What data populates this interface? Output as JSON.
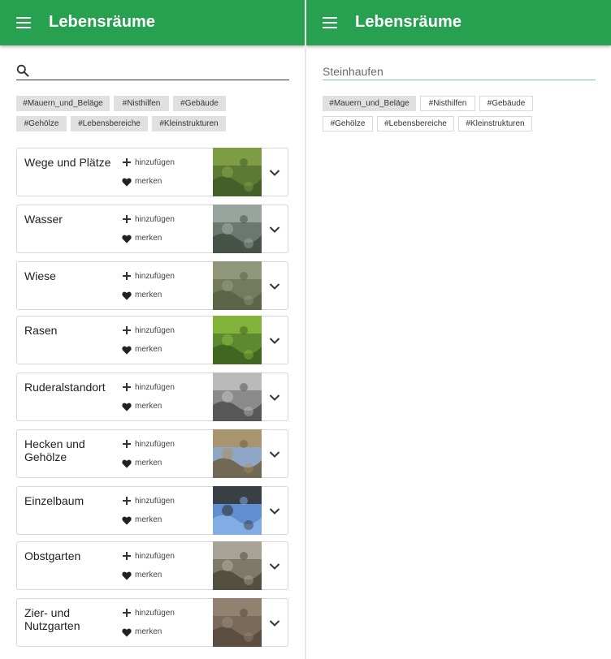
{
  "left": {
    "appbar": {
      "title": "Lebensräume",
      "menu_icon": "menu-icon"
    },
    "search": {
      "value": "",
      "placeholder": "",
      "icon": "search-icon"
    },
    "tags": [
      {
        "label": "#Mauern_und_Beläge"
      },
      {
        "label": "#Nisthilfen"
      },
      {
        "label": "#Gebäude"
      },
      {
        "label": "#Gehölze"
      },
      {
        "label": "#Lebensbereiche"
      },
      {
        "label": "#Kleinstrukturen"
      }
    ],
    "cards": [
      {
        "title": "Wege und Plätze",
        "add_label": "hinzufügen",
        "fav_label": "merken",
        "thumb_colors": [
          "#5d7a35",
          "#8aa84a",
          "#3e5a25"
        ]
      },
      {
        "title": "Wasser",
        "add_label": "hinzufügen",
        "fav_label": "merken",
        "thumb_colors": [
          "#6c7770",
          "#a7b3ae",
          "#3d4a40"
        ]
      },
      {
        "title": "Wiese",
        "add_label": "hinzufügen",
        "fav_label": "merken",
        "thumb_colors": [
          "#747a5e",
          "#9aa082",
          "#55603f"
        ]
      },
      {
        "title": "Rasen",
        "add_label": "hinzufügen",
        "fav_label": "merken",
        "thumb_colors": [
          "#5d8a2f",
          "#8fbf3f",
          "#3b5c1d"
        ]
      },
      {
        "title": "Ruderalstandort",
        "add_label": "hinzufügen",
        "fav_label": "merken",
        "thumb_colors": [
          "#8a8a8a",
          "#c9c9c9",
          "#4a4a4a"
        ]
      },
      {
        "title": "Hecken und Gehölze",
        "add_label": "hinzufügen",
        "fav_label": "merken",
        "thumb_colors": [
          "#8fa6c4",
          "#b08e52",
          "#6a5a3a"
        ]
      },
      {
        "title": "Einzelbaum",
        "add_label": "hinzufügen",
        "fav_label": "merken",
        "thumb_colors": [
          "#5f8fd0",
          "#2d2418",
          "#8ab4e8"
        ]
      },
      {
        "title": "Obstgarten",
        "add_label": "hinzufügen",
        "fav_label": "merken",
        "thumb_colors": [
          "#7e7a6a",
          "#b5b2a6",
          "#4a4636"
        ]
      },
      {
        "title": "Zier- und Nutzgarten",
        "add_label": "hinzufügen",
        "fav_label": "merken",
        "thumb_colors": [
          "#7a6a5a",
          "#9a8a78",
          "#54463a"
        ]
      }
    ]
  },
  "right": {
    "appbar": {
      "title": "Lebensräume",
      "menu_icon": "menu-icon"
    },
    "search": {
      "value": "Steinhaufen"
    },
    "tags": [
      {
        "label": "#Mauern_und_Beläge",
        "active": true
      },
      {
        "label": "#Nisthilfen",
        "active": false
      },
      {
        "label": "#Gebäude",
        "active": false
      },
      {
        "label": "#Gehölze",
        "active": false
      },
      {
        "label": "#Lebensbereiche",
        "active": false
      },
      {
        "label": "#Kleinstrukturen",
        "active": false
      }
    ]
  },
  "colors": {
    "appbar": "#27a050",
    "tag_fill": "#e0e0e0",
    "card_border": "#d8d8d8",
    "search_underline_active": "#7fbcd0"
  }
}
